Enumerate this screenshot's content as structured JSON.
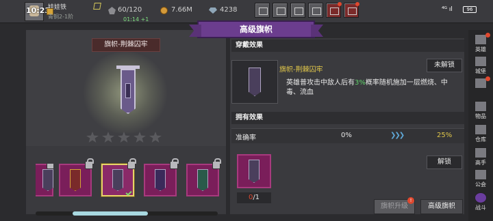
{
  "status_bar": {
    "clock": "10:23",
    "player_name": "娃娃铁",
    "rank": "青铜2-1阶",
    "stamina": "60/120",
    "stamina_timer": "01:14 +1",
    "coins": "7.66M",
    "gems": "4238",
    "system_status": "⁴ᴳ ıl",
    "battery": "96"
  },
  "header": {
    "title": "高级旗帜"
  },
  "preview": {
    "item_name": "旗帜-荆棘囚牢",
    "stars_total": 5,
    "stars_filled": 0
  },
  "wear_effect": {
    "section_title": "穿戴效果",
    "name": "旗帜-荆棘囚牢",
    "lock_state": "未解锁",
    "desc_before": "英雄普攻击中敌人后有",
    "desc_highlight": "3%",
    "desc_after": "概率随机施加一层燃烧、中毒、流血"
  },
  "owned_effect": {
    "section_title": "拥有效果",
    "stat_label": "准确率",
    "stat_from": "0%",
    "stat_arrows": "❯❯❯",
    "stat_to": "25%"
  },
  "cost": {
    "have": "0",
    "need": "/1"
  },
  "buttons": {
    "unlock": "解锁",
    "upgrade": "旗帜升级",
    "upgrade_badge": "!",
    "advanced": "高级旗帜"
  },
  "sidebar": {
    "items": [
      {
        "label": "英雄"
      },
      {
        "label": "城堡"
      },
      {
        "label": ""
      },
      {
        "label": "物品"
      },
      {
        "label": "仓库"
      },
      {
        "label": "高手"
      },
      {
        "label": "公会"
      },
      {
        "label": "战斗"
      }
    ]
  },
  "colors": {
    "accent_purple": "#6b3d8e",
    "highlight_green": "#5fd06a",
    "gold": "#e2c84a",
    "alert_red": "#e0482e"
  }
}
